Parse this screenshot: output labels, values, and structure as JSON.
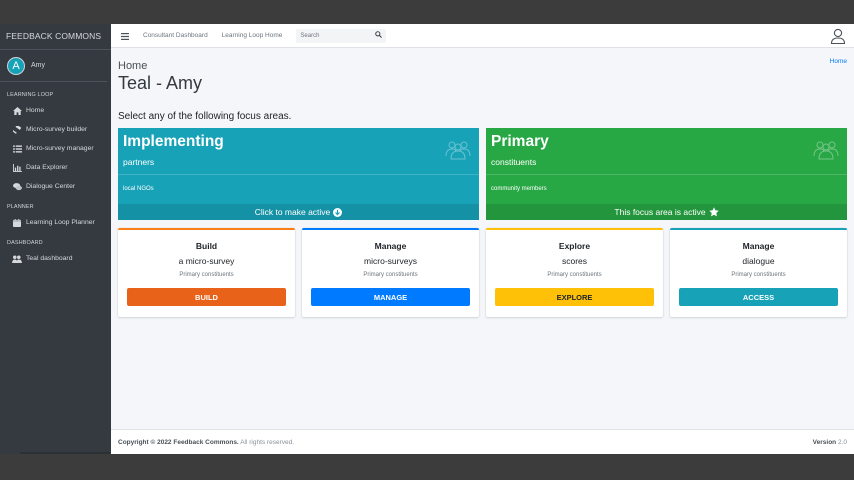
{
  "brand": "FEEDBACK COMMONS",
  "user": {
    "initial": "A",
    "name": "Amy"
  },
  "sidebar": {
    "sections": [
      {
        "header": "LEARNING LOOP",
        "items": [
          {
            "label": "Home",
            "icon": "home-icon"
          },
          {
            "label": "Micro-survey builder",
            "icon": "hammer-icon"
          },
          {
            "label": "Micro-survey manager",
            "icon": "list-icon"
          },
          {
            "label": "Data Explorer",
            "icon": "chart-icon"
          },
          {
            "label": "Dialogue Center",
            "icon": "comments-icon"
          }
        ]
      },
      {
        "header": "PLANNER",
        "items": [
          {
            "label": "Learning Loop Planner",
            "icon": "calendar-icon"
          }
        ]
      },
      {
        "header": "DASHBOARD",
        "items": [
          {
            "label": "Teal dashboard",
            "icon": "users-icon"
          }
        ]
      }
    ]
  },
  "topbar": {
    "links": [
      "Consultant Dashboard",
      "Learning Loop Home"
    ],
    "search_placeholder": "Search"
  },
  "breadcrumb": {
    "title": "Home",
    "link": "Home"
  },
  "page_title": "Teal - Amy",
  "intro": "Select any of the following focus areas.",
  "focus_areas": [
    {
      "title": "Implementing",
      "subtitle": "partners",
      "detail": "local NGOs",
      "footer": "Click to make active",
      "color": "#17a2b8"
    },
    {
      "title": "Primary",
      "subtitle": "constituents",
      "detail": "community members",
      "footer": "This focus area is active",
      "color": "#28a745"
    }
  ],
  "cards": [
    {
      "title": "Build",
      "line2": "a micro-survey",
      "line3": "Primary constituents",
      "button": "BUILD",
      "color": "#e8621a",
      "top": "#fd7e14"
    },
    {
      "title": "Manage",
      "line2": "micro-surveys",
      "line3": "Primary constituents",
      "button": "MANAGE",
      "color": "#007bff",
      "top": "#007bff"
    },
    {
      "title": "Explore",
      "line2": "scores",
      "line3": "Primary constituents",
      "button": "EXPLORE",
      "color": "#ffc107",
      "top": "#ffc107"
    },
    {
      "title": "Manage",
      "line2": "dialogue",
      "line3": "Primary constituents",
      "button": "ACCESS",
      "color": "#17a2b8",
      "top": "#17a2b8"
    }
  ],
  "footer": {
    "copyright": "Copyright © 2022 Feedback Commons.",
    "rights": "All rights reserved.",
    "version_label": "Version",
    "version": "2.0"
  }
}
